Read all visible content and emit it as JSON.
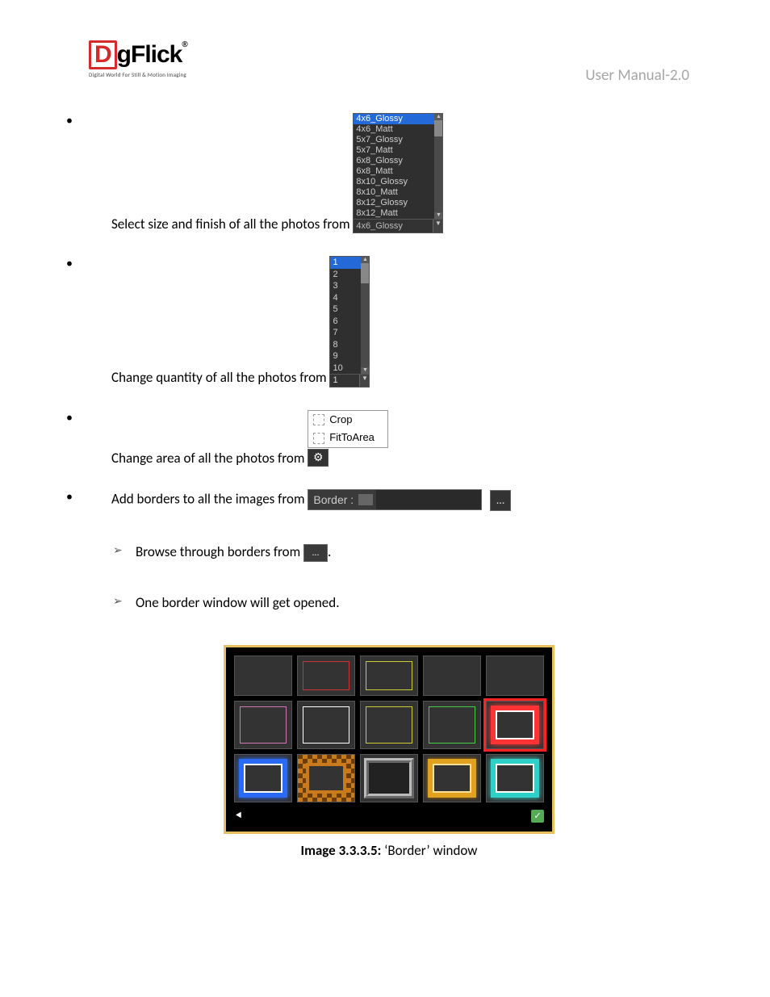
{
  "header": {
    "logo_d": "D",
    "logo_rest": "gFlick",
    "logo_r": "®",
    "logo_tagline": "Digital World For Still & Motion Imaging",
    "manual_version": "User Manual-2.0"
  },
  "bullets": {
    "size_text": "Select size and finish of all the photos from ",
    "qty_text": "Change quantity of all the photos from ",
    "area_text": "Change area of all the photos from ",
    "border_text": "Add borders to all the images from ",
    "browse_text_a": "Browse through borders from",
    "browse_text_b": ".",
    "opened_text": "One border window will get opened."
  },
  "size_dropdown": {
    "items": [
      "4x6_Glossy",
      "4x6_Matt",
      "5x7_Glossy",
      "5x7_Matt",
      "6x8_Glossy",
      "6x8_Matt",
      "8x10_Glossy",
      "8x10_Matt",
      "8x12_Glossy",
      "8x12_Matt"
    ],
    "selected_index": 0,
    "current": "4x6_Glossy"
  },
  "qty_dropdown": {
    "items": [
      "1",
      "2",
      "3",
      "4",
      "5",
      "6",
      "7",
      "8",
      "9",
      "10"
    ],
    "selected_index": 0,
    "current": "1"
  },
  "area_menu": {
    "item1": "Crop",
    "item2": "FitToArea",
    "gear": "⚙"
  },
  "border_bar": {
    "label": "Border :",
    "more": "…"
  },
  "browse_btn": {
    "dots": "…"
  },
  "border_window": {
    "back": "⯇",
    "ok": "✓"
  },
  "caption": {
    "bold": "Image 3.3.3.5:",
    "rest": " ‘Border’ window"
  }
}
